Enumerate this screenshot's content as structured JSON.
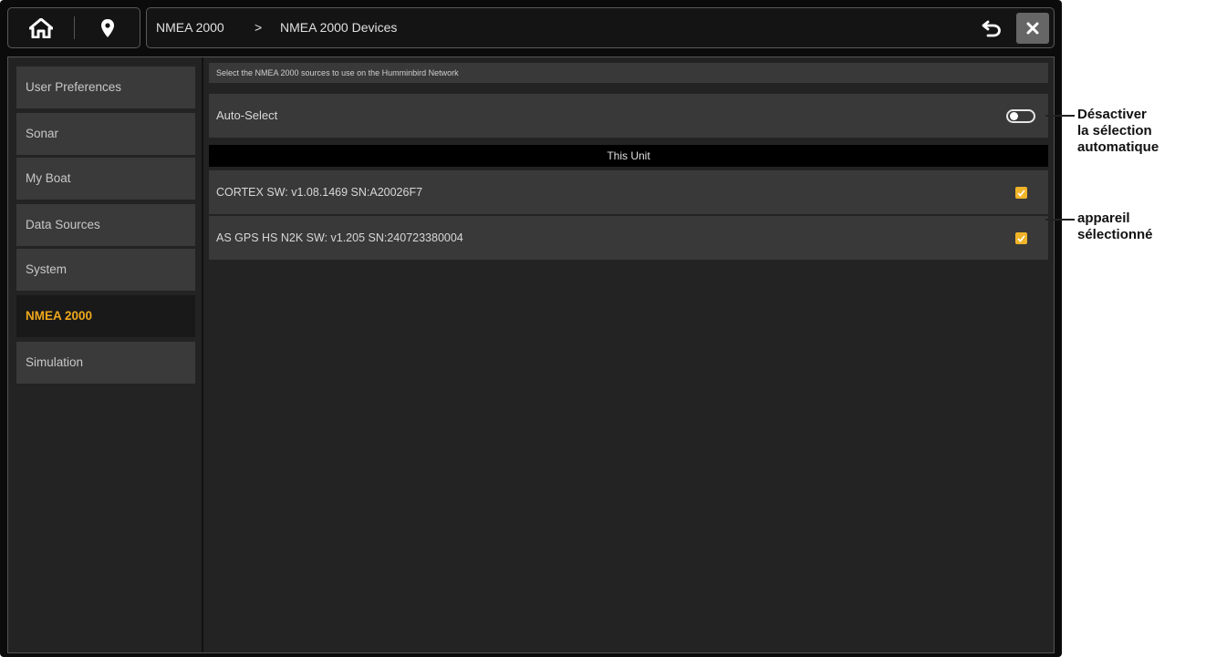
{
  "topbar": {
    "home_icon": "home-icon",
    "location_icon": "map-pin-icon",
    "breadcrumb": [
      "NMEA 2000",
      ">",
      "NMEA 2000 Devices"
    ],
    "back_icon": "undo-arrow-icon",
    "close_icon": "close-icon"
  },
  "sidebar": {
    "items": [
      {
        "label": "User Preferences"
      },
      {
        "label": "Sonar"
      },
      {
        "label": "My Boat"
      },
      {
        "label": "Data Sources"
      },
      {
        "label": "System"
      },
      {
        "label": "NMEA 2000",
        "active": true
      },
      {
        "label": "Simulation"
      }
    ]
  },
  "main": {
    "info_text": "Select the NMEA 2000 sources to use on the Humminbird Network",
    "auto_select": {
      "label": "Auto-Select",
      "state": "off"
    },
    "section_header": "This Unit",
    "devices": [
      {
        "label": "CORTEX SW: v1.08.1469 SN:A20026F7",
        "checked": true
      },
      {
        "label": "AS GPS HS N2K SW: v1.205 SN:240723380004",
        "checked": true
      }
    ]
  },
  "annotations": {
    "toggle_callout": [
      "Désactiver",
      "la sélection",
      "automatique"
    ],
    "device_callout": [
      "appareil",
      "sélectionné"
    ]
  },
  "colors": {
    "accent": "#f0a81c",
    "checkbox": "#f0b429",
    "panel": "#393939",
    "background": "#232323"
  }
}
